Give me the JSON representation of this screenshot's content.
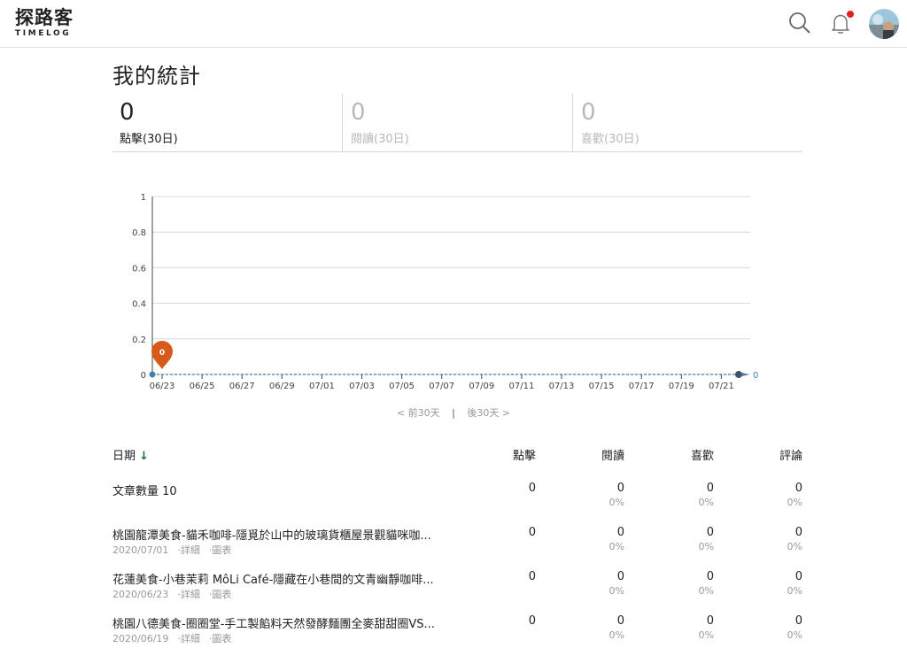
{
  "header": {
    "logo_cn": "探路客",
    "logo_en": "TIMELOG"
  },
  "page": {
    "title": "我的統計"
  },
  "stats": [
    {
      "value": "0",
      "label": "點擊(30日)",
      "active": true
    },
    {
      "value": "0",
      "label": "閱讀(30日)",
      "active": false
    },
    {
      "value": "0",
      "label": "喜歡(30日)",
      "active": false
    }
  ],
  "chart_data": {
    "type": "line",
    "title": "",
    "xlabel": "",
    "ylabel": "",
    "ylim": [
      0,
      1
    ],
    "yticks": [
      "0",
      "0.2",
      "0.4",
      "0.6",
      "0.8",
      "1"
    ],
    "categories": [
      "06/23",
      "06/25",
      "06/27",
      "06/29",
      "07/01",
      "07/03",
      "07/05",
      "07/07",
      "07/09",
      "07/11",
      "07/13",
      "07/15",
      "07/17",
      "07/19",
      "07/21"
    ],
    "series": [
      {
        "values": [
          0,
          0,
          0,
          0,
          0,
          0,
          0,
          0,
          0,
          0,
          0,
          0,
          0,
          0,
          0,
          0
        ]
      }
    ],
    "start_marker_label": "0",
    "end_label": "0",
    "grid": true
  },
  "pager": {
    "prev": "< 前30天",
    "sep": "|",
    "next": "後30天 >"
  },
  "table": {
    "headers": {
      "date": "日期",
      "sort": "↓",
      "clicks": "點擊",
      "reads": "閱讀",
      "likes": "喜歡",
      "comments": "評論"
    },
    "summary": {
      "title": "文章數量 10",
      "clicks": "0",
      "reads": "0",
      "reads_pct": "0%",
      "likes": "0",
      "likes_pct": "0%",
      "comments": "0",
      "comments_pct": "0%"
    },
    "rows": [
      {
        "title": "桃園龍潭美食-貓禾咖啡-隱覓於山中的玻璃貨櫃屋景觀貓咪咖...",
        "date": "2020/07/01",
        "detail": "·詳細",
        "chart": "·圖表",
        "clicks": "0",
        "reads": "0",
        "reads_pct": "0%",
        "likes": "0",
        "likes_pct": "0%",
        "comments": "0",
        "comments_pct": "0%"
      },
      {
        "title": "花蓮美食-小巷茉莉 MôLi Café-隱藏在小巷間的文青幽靜咖啡...",
        "date": "2020/06/23",
        "detail": "·詳細",
        "chart": "·圖表",
        "clicks": "0",
        "reads": "0",
        "reads_pct": "0%",
        "likes": "0",
        "likes_pct": "0%",
        "comments": "0",
        "comments_pct": "0%"
      },
      {
        "title": "桃園八德美食-圈圈堂-手工製餡料天然發酵麵團全麥甜甜圈VS...",
        "date": "2020/06/19",
        "detail": "·詳細",
        "chart": "·圖表",
        "clicks": "0",
        "reads": "0",
        "reads_pct": "0%",
        "likes": "0",
        "likes_pct": "0%",
        "comments": "0",
        "comments_pct": "0%"
      }
    ]
  },
  "colors": {
    "marker": "#d85a1a",
    "line": "#4a7ea8",
    "grid": "#d8d8d8",
    "notification": "#e32020",
    "sort_arrow": "#1a6e2e"
  }
}
